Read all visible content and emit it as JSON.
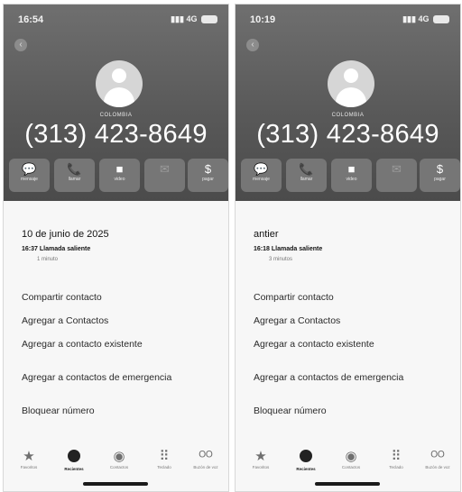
{
  "left": {
    "status": {
      "time": "16:54",
      "network": "4G"
    },
    "contact": {
      "country": "COLOMBIA",
      "number": "(313) 423-8649"
    },
    "actions": [
      {
        "label": "mensaje",
        "icon": "message-icon",
        "glyph": "💬"
      },
      {
        "label": "llamar",
        "icon": "phone-icon",
        "glyph": "📞"
      },
      {
        "label": "video",
        "icon": "video-icon",
        "glyph": "■"
      },
      {
        "label": "",
        "icon": "mail-icon",
        "glyph": "✉"
      },
      {
        "label": "pagar",
        "icon": "pay-icon",
        "glyph": "$"
      }
    ],
    "recent": {
      "date": "10 de junio de 2025",
      "time": "16:37",
      "type": "Llamada saliente",
      "duration": "1 minuto"
    },
    "options": [
      "Compartir contacto",
      "Agregar a Contactos",
      "Agregar a contacto existente",
      "Agregar a contactos de emergencia",
      "Bloquear número"
    ],
    "tabs": [
      "Favoritos",
      "Recientes",
      "Contactos",
      "Teclado",
      "Buzón de voz"
    ]
  },
  "right": {
    "status": {
      "time": "10:19",
      "network": "4G"
    },
    "contact": {
      "country": "COLOMBIA",
      "number": "(313) 423-8649"
    },
    "actions": [
      {
        "label": "mensaje",
        "icon": "message-icon",
        "glyph": "💬"
      },
      {
        "label": "llamar",
        "icon": "phone-icon",
        "glyph": "📞"
      },
      {
        "label": "video",
        "icon": "video-icon",
        "glyph": "■"
      },
      {
        "label": "",
        "icon": "mail-icon",
        "glyph": "✉"
      },
      {
        "label": "pagar",
        "icon": "pay-icon",
        "glyph": "$"
      }
    ],
    "recent": {
      "date": "antier",
      "time": "16:18",
      "type": "Llamada saliente",
      "duration": "3 minutos"
    },
    "options": [
      "Compartir contacto",
      "Agregar a Contactos",
      "Agregar a contacto existente",
      "Agregar a contactos de emergencia",
      "Bloquear número"
    ],
    "tabs": [
      "Favoritos",
      "Recientes",
      "Contactos",
      "Teclado",
      "Buzón de voz"
    ]
  }
}
